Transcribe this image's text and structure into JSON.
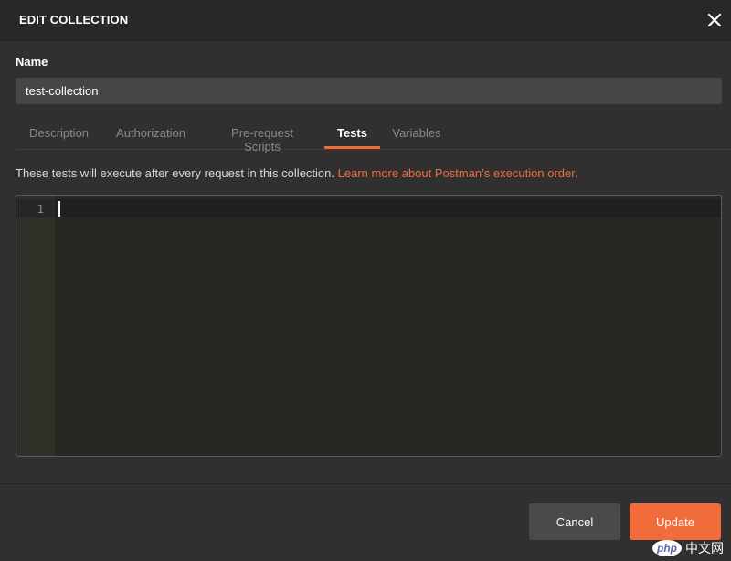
{
  "dialog": {
    "title": "EDIT COLLECTION",
    "close_icon": "close-icon"
  },
  "name_field": {
    "label": "Name",
    "value": "test-collection"
  },
  "tabs": [
    {
      "label": "Description",
      "active": false
    },
    {
      "label": "Authorization",
      "active": false
    },
    {
      "label": "Pre-request Scripts",
      "active": false
    },
    {
      "label": "Tests",
      "active": true
    },
    {
      "label": "Variables",
      "active": false
    }
  ],
  "info": {
    "text": "These tests will execute after every request in this collection.",
    "link": "Learn more about Postman’s execution order."
  },
  "editor": {
    "line_numbers": [
      "1"
    ],
    "content": ""
  },
  "footer": {
    "cancel_label": "Cancel",
    "update_label": "Update"
  },
  "watermark": {
    "logo_text": "php",
    "site_text": "中文网"
  },
  "colors": {
    "accent": "#f26b3a",
    "background": "#303030",
    "editor_bg": "#272822"
  }
}
